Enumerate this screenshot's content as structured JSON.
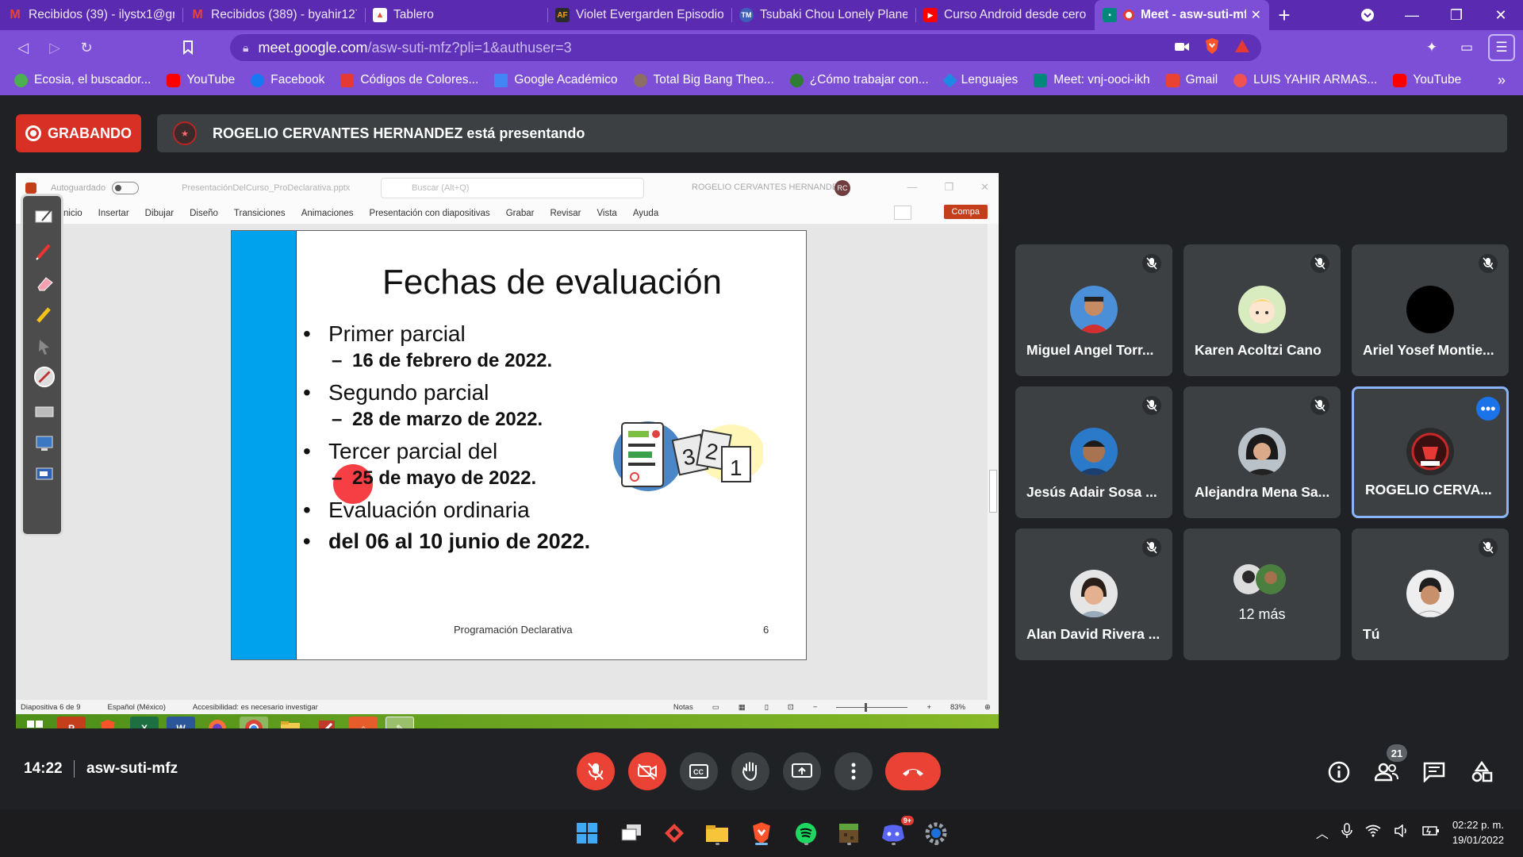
{
  "browser": {
    "tabs": [
      {
        "label": "Recibidos (39) - ilystx1@gm",
        "icon": "gmail-icon",
        "color": "#ea4335",
        "active": false
      },
      {
        "label": "Recibidos (389) - byahir127",
        "icon": "gmail-icon",
        "color": "#ea4335",
        "active": false
      },
      {
        "label": "Tablero",
        "icon": "tablero-icon",
        "color": "#e3542b",
        "active": false
      },
      {
        "label": "Violet Evergarden Episodio",
        "icon": "af-icon",
        "color": "#f6a21a",
        "active": false
      },
      {
        "label": "Tsubaki Chou Lonely Planet",
        "icon": "tmo-icon",
        "color": "#3d5fb5",
        "active": false
      },
      {
        "label": "Curso Android desde cero",
        "icon": "youtube-icon",
        "color": "#ff0000",
        "active": false
      },
      {
        "label": "Meet - asw-suti-mfz",
        "icon": "meet-icon",
        "color": "#00897b",
        "active": true
      }
    ],
    "url_domain": "meet.google.com",
    "url_path": "/asw-suti-mfz?pli=1&authuser=3",
    "bookmarks": [
      {
        "label": "Ecosia, el buscador...",
        "color": "#4caf50"
      },
      {
        "label": "YouTube",
        "color": "#ff0000"
      },
      {
        "label": "Facebook",
        "color": "#1877f2"
      },
      {
        "label": "Códigos de Colores...",
        "color": "#e53935"
      },
      {
        "label": "Google Académico",
        "color": "#4285f4"
      },
      {
        "label": "Total Big Bang Theo...",
        "color": "#8d6e63"
      },
      {
        "label": "¿Cómo trabajar con...",
        "color": "#2e7d32"
      },
      {
        "label": "Lenguajes",
        "color": "#1e88e5"
      },
      {
        "label": "Meet: vnj-ooci-ikh",
        "color": "#00897b"
      },
      {
        "label": "Gmail",
        "color": "#ea4335"
      },
      {
        "label": "LUIS YAHIR ARMAS...",
        "color": "#ef5350"
      },
      {
        "label": "YouTube",
        "color": "#ff0000"
      }
    ]
  },
  "meet": {
    "recording_label": "GRABANDO",
    "presenter_text": "ROGELIO CERVANTES HERNANDEZ está presentando",
    "clock": "14:22",
    "meeting_code": "asw-suti-mfz",
    "participant_count": "21",
    "participants": [
      {
        "name": "Miguel Angel Torr...",
        "muted": true,
        "avatar": "photo-male-1"
      },
      {
        "name": "Karen Acoltzi Cano",
        "muted": true,
        "avatar": "anime-avatar"
      },
      {
        "name": "Ariel Yosef Montie...",
        "muted": true,
        "avatar": "black-circle"
      },
      {
        "name": "Jesús Adair Sosa ...",
        "muted": true,
        "avatar": "photo-male-2"
      },
      {
        "name": "Alejandra Mena Sa...",
        "muted": true,
        "avatar": "photo-female-1"
      },
      {
        "name": "ROGELIO CERVA...",
        "muted": false,
        "avatar": "logo-avatar",
        "speaking": true
      },
      {
        "name": "Alan David Rivera ...",
        "muted": true,
        "avatar": "photo-male-3"
      },
      {
        "name": "12 más",
        "muted": false,
        "avatar": "group-avatars"
      },
      {
        "name": "Tú",
        "muted": true,
        "avatar": "photo-male-4"
      }
    ]
  },
  "powerpoint": {
    "autosave_label": "Autoguardado",
    "filename": "PresentaciónDelCurso_ProDeclarativa.pptx",
    "search_placeholder": "Buscar (Alt+Q)",
    "user_name": "ROGELIO CERVANTES HERNANDEZ",
    "user_initials": "RC",
    "share_label": "Compa",
    "ribbon_tabs": [
      "nicio",
      "Insertar",
      "Dibujar",
      "Diseño",
      "Transiciones",
      "Animaciones",
      "Presentación con diapositivas",
      "Grabar",
      "Revisar",
      "Vista",
      "Ayuda"
    ],
    "status": {
      "slide_info": "Diapositiva 6 de 9",
      "language": "Español (México)",
      "accessibility": "Accesibilidad: es necesario investigar",
      "notes": "Notas",
      "zoom": "83%"
    }
  },
  "slide": {
    "title": "Fechas de evaluación",
    "items": [
      {
        "level": 1,
        "text": "Primer parcial"
      },
      {
        "level": 2,
        "text": "16 de febrero de 2022."
      },
      {
        "level": 1,
        "text": "Segundo parcial"
      },
      {
        "level": 2,
        "text": "28 de marzo de 2022."
      },
      {
        "level": 1,
        "text": "Tercer parcial del"
      },
      {
        "level": 2,
        "text": "25 de mayo de 2022."
      },
      {
        "level": 1,
        "text": "Evaluación ordinaria"
      },
      {
        "level": 1,
        "text": "del 06 al 10 junio de 2022.",
        "bold": true
      }
    ],
    "footer": "Programación  Declarativa",
    "page_number": "6"
  },
  "taskbar": {
    "time": "02:22 p. m.",
    "date": "19/01/2022",
    "discord_badge": "9+"
  },
  "colors": {
    "chrome_purple": "#7d4fd6",
    "meet_bg": "#202124",
    "tile_bg": "#3c4043",
    "danger": "#ea4335",
    "slide_stripe": "#00a2ed"
  }
}
